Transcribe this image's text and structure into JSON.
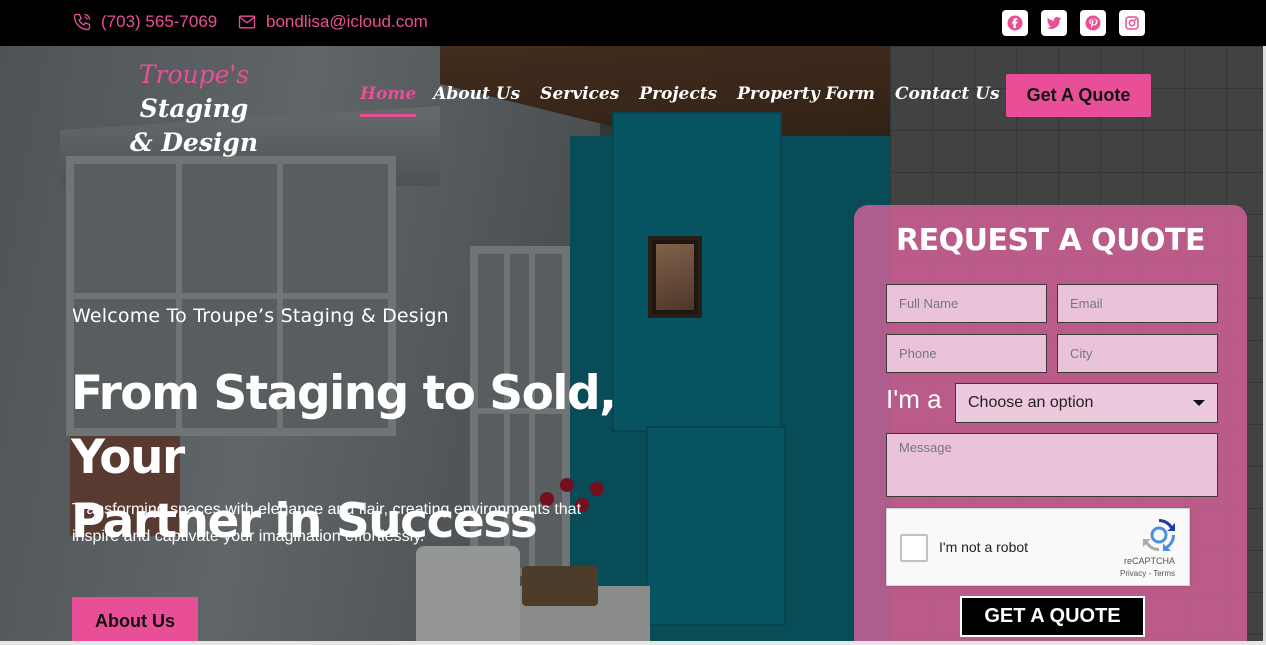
{
  "topbar": {
    "phone": "(703) 565-7069",
    "email": "bondlisa@icloud.com",
    "socials": [
      "facebook-icon",
      "twitter-icon",
      "pinterest-icon",
      "instagram-icon"
    ]
  },
  "brand": {
    "logo_pink": "Troupe's",
    "logo_line1": "Staging",
    "logo_line2": "& Design"
  },
  "nav": {
    "items": [
      "Home",
      "About Us",
      "Services",
      "Projects",
      "Property Form",
      "Contact Us"
    ],
    "active": "Home",
    "quote_button": "Get A Quote"
  },
  "hero": {
    "welcome": "Welcome To Troupe’s Staging & Design",
    "headline_line1": "From Staging to Sold, Your",
    "headline_line2": "Partner in Success",
    "sub_line1": "Transforming spaces with elegance and flair, creating environments that",
    "sub_line2": "inspire and captivate your imagination effortlessly.",
    "about_button": "About Us"
  },
  "form": {
    "title": "REQUEST A QUOTE",
    "full_name_placeholder": "Full Name",
    "email_placeholder": "Email",
    "phone_placeholder": "Phone",
    "city_placeholder": "City",
    "ima_label": "I'm a",
    "select_value": "Choose an option",
    "message_placeholder": "Message",
    "captcha_label": "I'm not a robot",
    "captcha_brand": "reCAPTCHA",
    "captcha_terms": "Privacy - Terms",
    "submit": "GET A QUOTE"
  },
  "colors": {
    "accent": "#e94f96",
    "topbar": "#000000",
    "form_bg": "#dd639e"
  }
}
